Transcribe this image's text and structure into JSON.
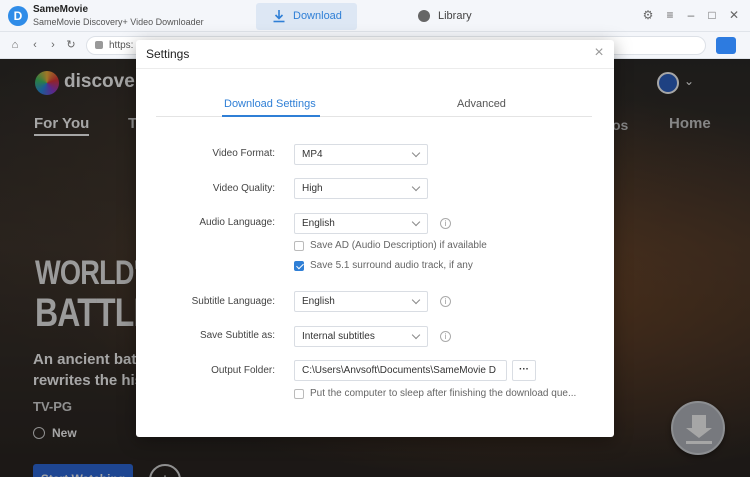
{
  "app": {
    "name": "SameMovie",
    "subtitle": "SameMovie Discovery+ Video Downloader",
    "logo_letter": "D",
    "tabs": {
      "download": "Download",
      "library": "Library"
    }
  },
  "browser": {
    "url": "https:"
  },
  "site": {
    "brand": "discovery",
    "nav": {
      "for_you": "For You",
      "t": "T",
      "os": "os",
      "home": "Home"
    },
    "hero_line1": "WORLD'S",
    "hero_line2": "BATTLEF",
    "tagline_1": "An ancient battl",
    "tagline_2": "rewrites the hist",
    "rating": "TV-PG",
    "new_label": "New",
    "watch_label": "Start Watching",
    "plus_label": "+"
  },
  "settings": {
    "title": "Settings",
    "close": "×",
    "tabs": {
      "download_settings": "Download Settings",
      "advanced": "Advanced"
    },
    "video_format": {
      "label": "Video Format:",
      "value": "MP4"
    },
    "video_quality": {
      "label": "Video Quality:",
      "value": "High"
    },
    "audio_language": {
      "label": "Audio Language:",
      "value": "English"
    },
    "save_ad": {
      "label": "Save AD (Audio Description) if available",
      "checked": false
    },
    "save_51": {
      "label": "Save 5.1 surround audio track, if any",
      "checked": true
    },
    "subtitle_language": {
      "label": "Subtitle Language:",
      "value": "English"
    },
    "save_subtitle_as": {
      "label": "Save Subtitle as:",
      "value": "Internal subtitles"
    },
    "output_folder": {
      "label": "Output Folder:",
      "value": "C:\\Users\\Anvsoft\\Documents\\SameMovie D",
      "browse": "···"
    },
    "sleep": {
      "label": "Put the computer to sleep after finishing the download que...",
      "checked": false
    },
    "info_glyph": "i"
  },
  "colors": {
    "accent": "#2f7fd6",
    "watch_button": "#2f6ce0"
  }
}
